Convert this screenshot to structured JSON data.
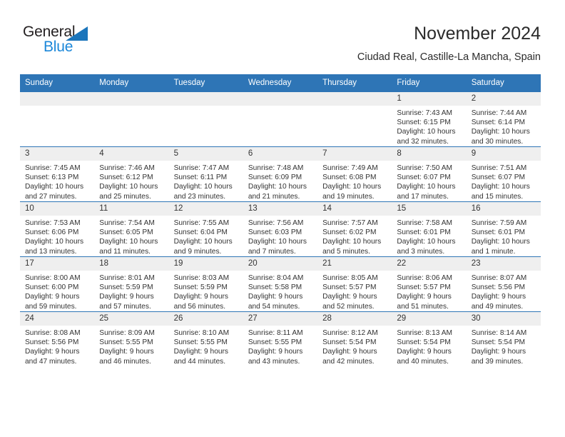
{
  "brand": {
    "name_part1": "General",
    "name_part2": "Blue",
    "accent_color": "#1b75bb",
    "blue_text_color": "#1b87d9",
    "triangle_icon": "triangle-icon"
  },
  "header": {
    "title": "November 2024",
    "subtitle": "Ciudad Real, Castille-La Mancha, Spain"
  },
  "theme": {
    "header_blue": "#2e75b6",
    "daynum_gray": "#efefef",
    "text": "#333333"
  },
  "weekdays": [
    "Sunday",
    "Monday",
    "Tuesday",
    "Wednesday",
    "Thursday",
    "Friday",
    "Saturday"
  ],
  "weeks": [
    [
      {
        "day": "",
        "empty": true,
        "sunrise": "",
        "sunset": "",
        "daylight1": "",
        "daylight2": ""
      },
      {
        "day": "",
        "empty": true,
        "sunrise": "",
        "sunset": "",
        "daylight1": "",
        "daylight2": ""
      },
      {
        "day": "",
        "empty": true,
        "sunrise": "",
        "sunset": "",
        "daylight1": "",
        "daylight2": ""
      },
      {
        "day": "",
        "empty": true,
        "sunrise": "",
        "sunset": "",
        "daylight1": "",
        "daylight2": ""
      },
      {
        "day": "",
        "empty": true,
        "sunrise": "",
        "sunset": "",
        "daylight1": "",
        "daylight2": ""
      },
      {
        "day": "1",
        "empty": false,
        "sunrise": "Sunrise: 7:43 AM",
        "sunset": "Sunset: 6:15 PM",
        "daylight1": "Daylight: 10 hours",
        "daylight2": "and 32 minutes."
      },
      {
        "day": "2",
        "empty": false,
        "sunrise": "Sunrise: 7:44 AM",
        "sunset": "Sunset: 6:14 PM",
        "daylight1": "Daylight: 10 hours",
        "daylight2": "and 30 minutes."
      }
    ],
    [
      {
        "day": "3",
        "empty": false,
        "sunrise": "Sunrise: 7:45 AM",
        "sunset": "Sunset: 6:13 PM",
        "daylight1": "Daylight: 10 hours",
        "daylight2": "and 27 minutes."
      },
      {
        "day": "4",
        "empty": false,
        "sunrise": "Sunrise: 7:46 AM",
        "sunset": "Sunset: 6:12 PM",
        "daylight1": "Daylight: 10 hours",
        "daylight2": "and 25 minutes."
      },
      {
        "day": "5",
        "empty": false,
        "sunrise": "Sunrise: 7:47 AM",
        "sunset": "Sunset: 6:11 PM",
        "daylight1": "Daylight: 10 hours",
        "daylight2": "and 23 minutes."
      },
      {
        "day": "6",
        "empty": false,
        "sunrise": "Sunrise: 7:48 AM",
        "sunset": "Sunset: 6:09 PM",
        "daylight1": "Daylight: 10 hours",
        "daylight2": "and 21 minutes."
      },
      {
        "day": "7",
        "empty": false,
        "sunrise": "Sunrise: 7:49 AM",
        "sunset": "Sunset: 6:08 PM",
        "daylight1": "Daylight: 10 hours",
        "daylight2": "and 19 minutes."
      },
      {
        "day": "8",
        "empty": false,
        "sunrise": "Sunrise: 7:50 AM",
        "sunset": "Sunset: 6:07 PM",
        "daylight1": "Daylight: 10 hours",
        "daylight2": "and 17 minutes."
      },
      {
        "day": "9",
        "empty": false,
        "sunrise": "Sunrise: 7:51 AM",
        "sunset": "Sunset: 6:07 PM",
        "daylight1": "Daylight: 10 hours",
        "daylight2": "and 15 minutes."
      }
    ],
    [
      {
        "day": "10",
        "empty": false,
        "sunrise": "Sunrise: 7:53 AM",
        "sunset": "Sunset: 6:06 PM",
        "daylight1": "Daylight: 10 hours",
        "daylight2": "and 13 minutes."
      },
      {
        "day": "11",
        "empty": false,
        "sunrise": "Sunrise: 7:54 AM",
        "sunset": "Sunset: 6:05 PM",
        "daylight1": "Daylight: 10 hours",
        "daylight2": "and 11 minutes."
      },
      {
        "day": "12",
        "empty": false,
        "sunrise": "Sunrise: 7:55 AM",
        "sunset": "Sunset: 6:04 PM",
        "daylight1": "Daylight: 10 hours",
        "daylight2": "and 9 minutes."
      },
      {
        "day": "13",
        "empty": false,
        "sunrise": "Sunrise: 7:56 AM",
        "sunset": "Sunset: 6:03 PM",
        "daylight1": "Daylight: 10 hours",
        "daylight2": "and 7 minutes."
      },
      {
        "day": "14",
        "empty": false,
        "sunrise": "Sunrise: 7:57 AM",
        "sunset": "Sunset: 6:02 PM",
        "daylight1": "Daylight: 10 hours",
        "daylight2": "and 5 minutes."
      },
      {
        "day": "15",
        "empty": false,
        "sunrise": "Sunrise: 7:58 AM",
        "sunset": "Sunset: 6:01 PM",
        "daylight1": "Daylight: 10 hours",
        "daylight2": "and 3 minutes."
      },
      {
        "day": "16",
        "empty": false,
        "sunrise": "Sunrise: 7:59 AM",
        "sunset": "Sunset: 6:01 PM",
        "daylight1": "Daylight: 10 hours",
        "daylight2": "and 1 minute."
      }
    ],
    [
      {
        "day": "17",
        "empty": false,
        "sunrise": "Sunrise: 8:00 AM",
        "sunset": "Sunset: 6:00 PM",
        "daylight1": "Daylight: 9 hours",
        "daylight2": "and 59 minutes."
      },
      {
        "day": "18",
        "empty": false,
        "sunrise": "Sunrise: 8:01 AM",
        "sunset": "Sunset: 5:59 PM",
        "daylight1": "Daylight: 9 hours",
        "daylight2": "and 57 minutes."
      },
      {
        "day": "19",
        "empty": false,
        "sunrise": "Sunrise: 8:03 AM",
        "sunset": "Sunset: 5:59 PM",
        "daylight1": "Daylight: 9 hours",
        "daylight2": "and 56 minutes."
      },
      {
        "day": "20",
        "empty": false,
        "sunrise": "Sunrise: 8:04 AM",
        "sunset": "Sunset: 5:58 PM",
        "daylight1": "Daylight: 9 hours",
        "daylight2": "and 54 minutes."
      },
      {
        "day": "21",
        "empty": false,
        "sunrise": "Sunrise: 8:05 AM",
        "sunset": "Sunset: 5:57 PM",
        "daylight1": "Daylight: 9 hours",
        "daylight2": "and 52 minutes."
      },
      {
        "day": "22",
        "empty": false,
        "sunrise": "Sunrise: 8:06 AM",
        "sunset": "Sunset: 5:57 PM",
        "daylight1": "Daylight: 9 hours",
        "daylight2": "and 51 minutes."
      },
      {
        "day": "23",
        "empty": false,
        "sunrise": "Sunrise: 8:07 AM",
        "sunset": "Sunset: 5:56 PM",
        "daylight1": "Daylight: 9 hours",
        "daylight2": "and 49 minutes."
      }
    ],
    [
      {
        "day": "24",
        "empty": false,
        "sunrise": "Sunrise: 8:08 AM",
        "sunset": "Sunset: 5:56 PM",
        "daylight1": "Daylight: 9 hours",
        "daylight2": "and 47 minutes."
      },
      {
        "day": "25",
        "empty": false,
        "sunrise": "Sunrise: 8:09 AM",
        "sunset": "Sunset: 5:55 PM",
        "daylight1": "Daylight: 9 hours",
        "daylight2": "and 46 minutes."
      },
      {
        "day": "26",
        "empty": false,
        "sunrise": "Sunrise: 8:10 AM",
        "sunset": "Sunset: 5:55 PM",
        "daylight1": "Daylight: 9 hours",
        "daylight2": "and 44 minutes."
      },
      {
        "day": "27",
        "empty": false,
        "sunrise": "Sunrise: 8:11 AM",
        "sunset": "Sunset: 5:55 PM",
        "daylight1": "Daylight: 9 hours",
        "daylight2": "and 43 minutes."
      },
      {
        "day": "28",
        "empty": false,
        "sunrise": "Sunrise: 8:12 AM",
        "sunset": "Sunset: 5:54 PM",
        "daylight1": "Daylight: 9 hours",
        "daylight2": "and 42 minutes."
      },
      {
        "day": "29",
        "empty": false,
        "sunrise": "Sunrise: 8:13 AM",
        "sunset": "Sunset: 5:54 PM",
        "daylight1": "Daylight: 9 hours",
        "daylight2": "and 40 minutes."
      },
      {
        "day": "30",
        "empty": false,
        "sunrise": "Sunrise: 8:14 AM",
        "sunset": "Sunset: 5:54 PM",
        "daylight1": "Daylight: 9 hours",
        "daylight2": "and 39 minutes."
      }
    ]
  ]
}
